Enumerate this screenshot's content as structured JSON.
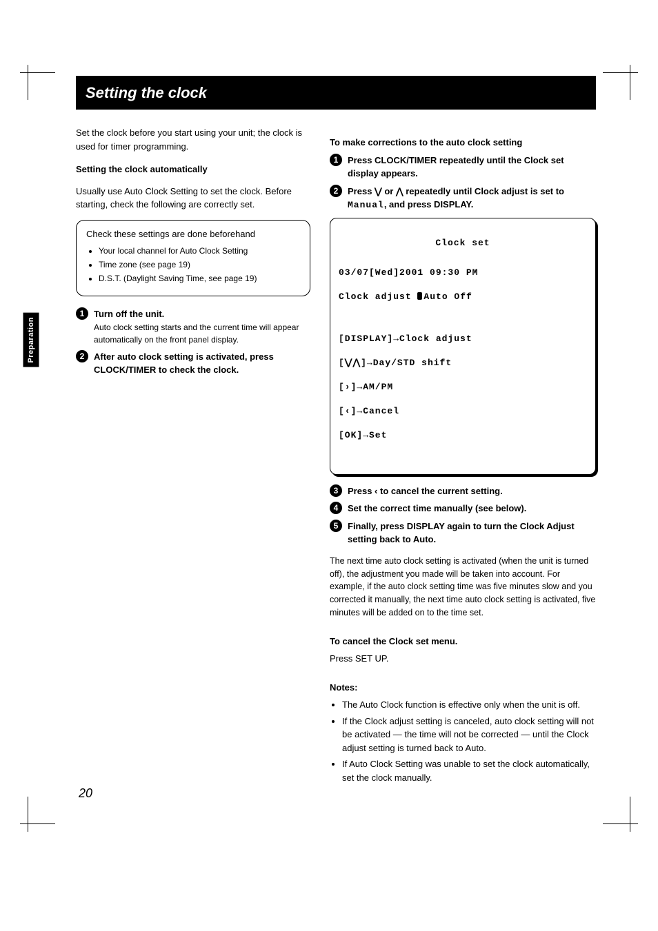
{
  "page_number": "20",
  "side_tab": "Preparation",
  "header": "Setting the clock",
  "left": {
    "intro": "Set the clock before you start using your unit; the clock is used for timer programming.",
    "auto_heading": "Setting the clock automatically",
    "auto_para": "Usually use Auto Clock Setting to set the clock. Before starting, check the following are correctly set.",
    "note_header": "Check these settings are done beforehand",
    "note_items": [
      "Your local channel for Auto Clock Setting",
      "Time zone (see page 19)",
      "D.S.T. (Daylight Saving Time, see page 19)"
    ],
    "step1": "Turn off the unit.",
    "step1_sub": "Auto clock setting starts and the current time will appear automatically on the front panel display.",
    "step2": "After auto clock setting is activated, press CLOCK/TIMER to check the clock."
  },
  "right": {
    "panel_title": "To make corrections to the auto clock setting",
    "step1": "Press CLOCK/TIMER repeatedly until the Clock set display appears.",
    "step2_a": "Press ",
    "step2_b": " or ",
    "step2_c": " repeatedly until Clock adjust is set to ",
    "step2_d": "Manual",
    "step2_e": ", and press DISPLAY.",
    "osd": {
      "title": "Clock set",
      "line1": "03/07[Wed]2001 09:30 PM",
      "line2a": "Clock adjust ",
      "line2b": "Auto Off",
      "line3": "[DISPLAY]→Clock adjust",
      "line4": "[⋁⋀]→Day/STD shift",
      "line5": "[›]→AM/PM",
      "line6": "[‹]→Cancel",
      "line7": "[OK]→Set"
    },
    "step3_a": "Press ",
    "step3_b": " to cancel the current setting.",
    "step4": "Set the correct time manually (see below).",
    "step5": "Finally, press DISPLAY again to turn the Clock Adjust setting back to Auto.",
    "auto_on_para": "The next time auto clock setting is activated (when the unit is turned off), the adjustment you made will be taken into account. For example, if the auto clock setting time was five minutes slow and you corrected it manually, the next time auto clock setting is activated, five minutes will be added on to the time set.",
    "cancel_head": "To cancel the Clock set menu.",
    "cancel_body": "Press SET UP.",
    "notes_head": "Notes:",
    "notes": [
      "The Auto Clock function is effective only when the unit is off.",
      "If the Clock adjust setting is canceled, auto clock setting will not be activated — the time will not be corrected — until the Clock adjust setting is turned back to Auto.",
      "If Auto Clock Setting was unable to set the clock automatically, set the clock manually."
    ]
  }
}
